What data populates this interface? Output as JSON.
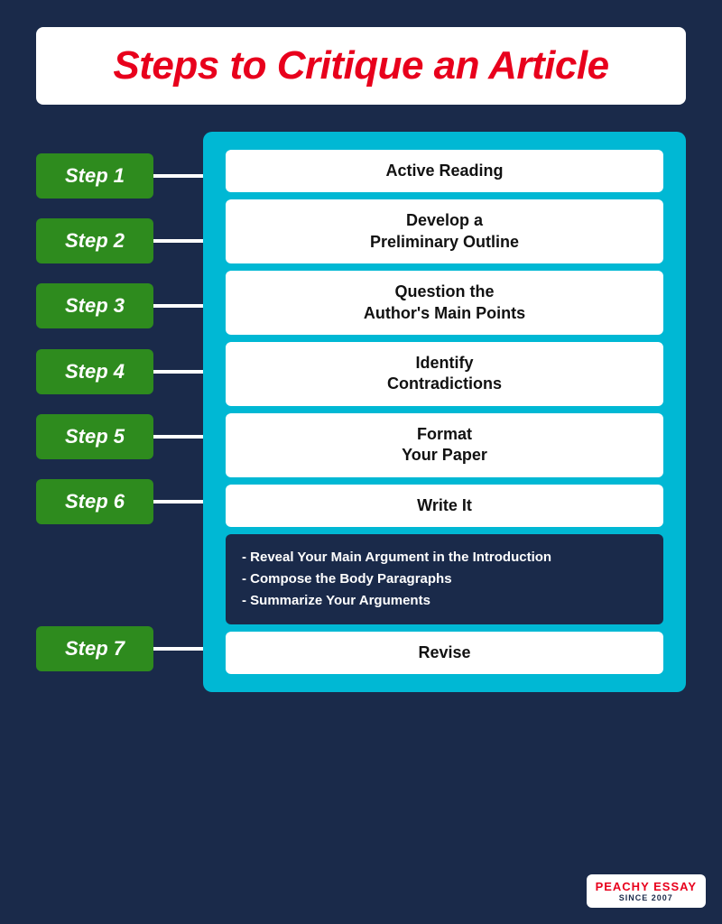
{
  "title": "Steps to Critique an Article",
  "steps": [
    {
      "label": "Step 1",
      "content": "Active Reading",
      "multiline": false
    },
    {
      "label": "Step 2",
      "content": "Develop a\nPreliminary Outline",
      "multiline": true
    },
    {
      "label": "Step 3",
      "content": "Question the\nAuthor's Main Points",
      "multiline": true
    },
    {
      "label": "Step 4",
      "content": "Identify\nContradictions",
      "multiline": true
    },
    {
      "label": "Step 5",
      "content": "Format\nYour Paper",
      "multiline": true
    },
    {
      "label": "Step 6",
      "content": "Write It",
      "multiline": false
    },
    {
      "label": "Step 7",
      "content": "Revise",
      "multiline": false
    }
  ],
  "step6_subpoints": [
    "- Reveal Your Main Argument in the Introduction",
    "- Compose the Body Paragraphs",
    "- Summarize Your Arguments"
  ],
  "logo": {
    "name": "PEACHY ESSAY",
    "sub": "SINCE 2007"
  }
}
